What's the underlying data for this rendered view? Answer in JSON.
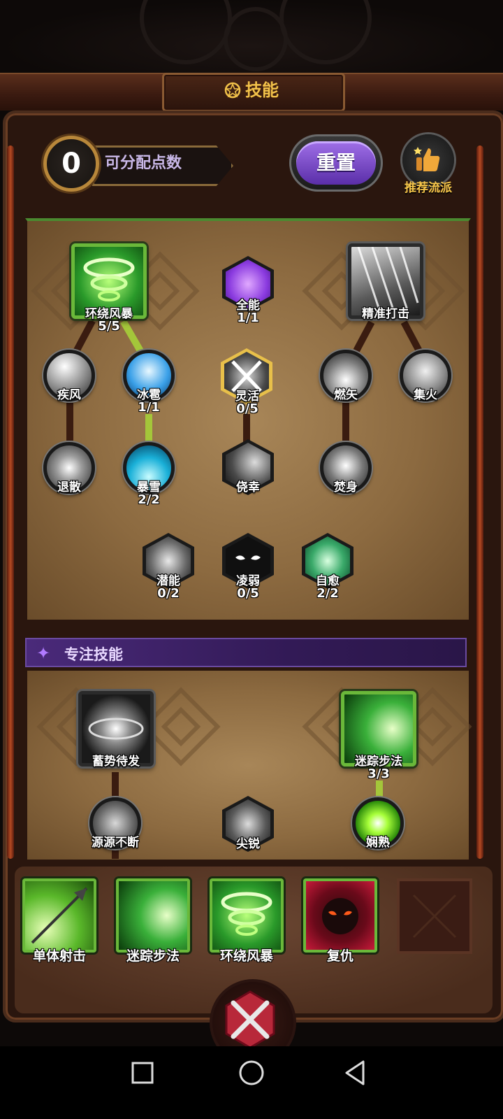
{
  "header": {
    "title": "技能",
    "title_icon": "pentagram-icon",
    "points_value": "0",
    "points_label": "可分配点数",
    "reset_label": "重置",
    "recommend_label": "推荐流派"
  },
  "tree_main": {
    "nodes": [
      {
        "id": "circling-storm",
        "label": "环绕风暴",
        "count": "5/5",
        "icon": "green-tornado-icon"
      },
      {
        "id": "omni",
        "label": "全能",
        "count": "1/1",
        "icon": "purple-heart-icon"
      },
      {
        "id": "precise-strike",
        "label": "精准打击",
        "icon": "arrow-rain-icon"
      },
      {
        "id": "gale",
        "label": "疾风",
        "icon": "wind-icon"
      },
      {
        "id": "hail",
        "label": "冰雹",
        "count": "1/1",
        "icon": "ice-sphere-icon"
      },
      {
        "id": "agile",
        "label": "灵活",
        "count": "0/5",
        "icon": "crossed-blades-icon"
      },
      {
        "id": "burning-arrow",
        "label": "燃矢",
        "icon": "flame-arrow-icon"
      },
      {
        "id": "focus-fire",
        "label": "集火",
        "icon": "arrow-volley-icon"
      },
      {
        "id": "repel",
        "label": "退散",
        "icon": "burst-icon"
      },
      {
        "id": "blizzard",
        "label": "暴雪",
        "count": "2/2",
        "icon": "blizzard-icon"
      },
      {
        "id": "lucky",
        "label": "侥幸",
        "icon": "shadow-slash-icon"
      },
      {
        "id": "self-burn",
        "label": "焚身",
        "icon": "fire-body-icon"
      },
      {
        "id": "potential",
        "label": "潜能",
        "count": "0/2",
        "icon": "fist-icon"
      },
      {
        "id": "weakness",
        "label": "凌弱",
        "count": "0/5",
        "icon": "shadow-eyes-icon"
      },
      {
        "id": "self-heal",
        "label": "自愈",
        "count": "2/2",
        "icon": "leaf-heal-icon"
      }
    ]
  },
  "tree_focus": {
    "title": "专注技能",
    "nodes": [
      {
        "id": "charge-up",
        "label": "蓄势待发",
        "icon": "energy-orb-icon"
      },
      {
        "id": "elusive-step",
        "label": "迷踪步法",
        "count": "3/3",
        "icon": "green-dash-icon"
      },
      {
        "id": "endless-source",
        "label": "源源不断",
        "icon": "sparkle-cross-icon"
      },
      {
        "id": "sharp",
        "label": "尖锐",
        "icon": "sharp-arrow-icon"
      },
      {
        "id": "proficient",
        "label": "娴熟",
        "icon": "green-light-orb-icon"
      }
    ]
  },
  "hotbar": [
    {
      "label": "单体射击",
      "icon": "arrow-shot-icon"
    },
    {
      "label": "迷踪步法",
      "icon": "green-dash-icon"
    },
    {
      "label": "环绕风暴",
      "icon": "green-tornado-icon"
    },
    {
      "label": "复仇",
      "icon": "demon-face-icon"
    }
  ],
  "colors": {
    "gold": "#f2c24a",
    "active_green": "#a4c63a",
    "focus_purple": "#4a2a7a",
    "reset_purple": "#8a5ad8"
  }
}
